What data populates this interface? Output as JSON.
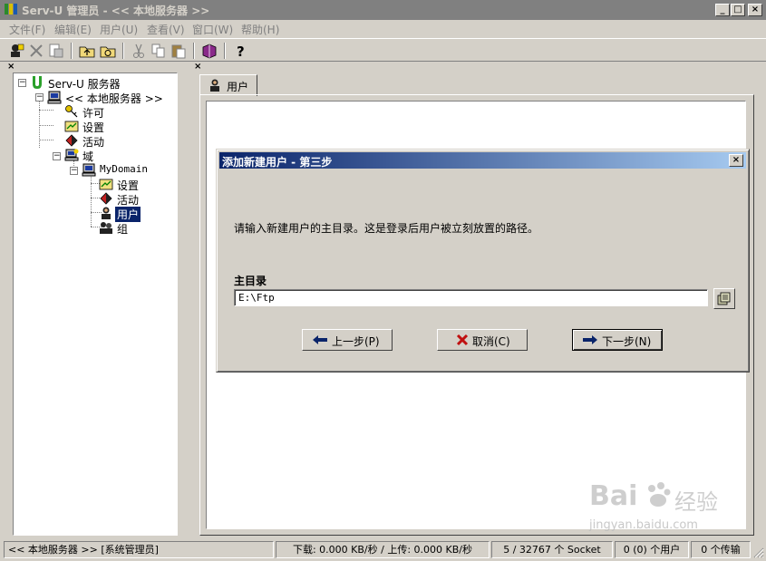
{
  "window": {
    "title": "Serv-U 管理员 - << 本地服务器 >>",
    "min_label": "_",
    "max_label": "□",
    "close_label": "×"
  },
  "menu": [
    "文件(F)",
    "编辑(E)",
    "用户(U)",
    "查看(V)",
    "窗口(W)",
    "帮助(H)"
  ],
  "tree": {
    "close_label": "×",
    "items": [
      {
        "label": "Serv-U 服务器",
        "icon": "serv-u-logo-icon"
      },
      {
        "label": "<< 本地服务器 >>",
        "icon": "computer-icon"
      },
      {
        "label": "许可",
        "icon": "key-icon"
      },
      {
        "label": "设置",
        "icon": "settings-icon"
      },
      {
        "label": "活动",
        "icon": "activity-icon"
      },
      {
        "label": "域",
        "icon": "domain-icon"
      },
      {
        "label": "MyDomain",
        "icon": "computer-icon"
      },
      {
        "label": "设置",
        "icon": "settings-icon"
      },
      {
        "label": "活动",
        "icon": "activity-icon"
      },
      {
        "label": "用户",
        "icon": "user-icon"
      },
      {
        "label": "组",
        "icon": "group-icon"
      }
    ]
  },
  "right": {
    "close_label": "×",
    "tab_label": "用户"
  },
  "dialog": {
    "title": "添加新建用户 - 第三步",
    "close_label": "×",
    "description": "请输入新建用户的主目录。这是登录后用户被立刻放置的路径。",
    "field_label": "主目录",
    "field_value": "E:\\Ftp",
    "back_label": "上一步(P)",
    "cancel_label": "取消(C)",
    "next_label": "下一步(N)"
  },
  "status": {
    "server": "<< 本地服务器 >>  [系统管理员]",
    "speed": "下载: 0.000 KB/秒 / 上传: 0.000 KB/秒",
    "sockets": "5 / 32767 个 Socket",
    "users": "0 (0) 个用户",
    "transfers": "0 个传输"
  },
  "watermark": {
    "brand": "Bai",
    "brand_cn": "经验",
    "url": "jingyan.baidu.com"
  },
  "colors": {
    "face": "#d4d0c8",
    "title_inactive": "#808080",
    "dialog_title_start": "#0a246a",
    "dialog_title_end": "#a6caf0",
    "selection": "#0a246a"
  }
}
